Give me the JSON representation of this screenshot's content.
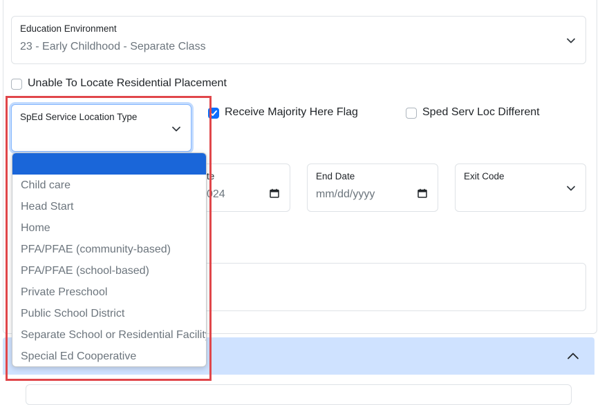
{
  "education_environment": {
    "label": "Education Environment",
    "value": "23 - Early Childhood - Separate Class",
    "icon": "chevron-down-icon"
  },
  "unable_to_locate": {
    "label": "Unable To Locate Residential Placement",
    "checked": false
  },
  "sped_location": {
    "label": "SpEd Service Location Type",
    "value": "",
    "icon": "chevron-down-icon",
    "options": [
      "",
      "Child care",
      "Head Start",
      "Home",
      "PFA/PFAE (community-based)",
      "PFA/PFAE (school-based)",
      "Private Preschool",
      "Public School District",
      "Separate School or Residential Facility",
      "Special Ed Cooperative"
    ],
    "selected_index": 0
  },
  "receive_majority": {
    "label": "Receive Majority Here Flag",
    "checked": true
  },
  "sped_loc_different": {
    "label": "Sped Serv Loc Different",
    "checked": false
  },
  "start_date": {
    "label_partial": "te",
    "value_partial": "024",
    "icon": "calendar-icon"
  },
  "end_date": {
    "label": "End Date",
    "placeholder": "mm/dd/yyyy",
    "icon": "calendar-icon"
  },
  "exit_code": {
    "label": "Exit Code",
    "value": "",
    "icon": "chevron-down-icon"
  },
  "accordion": {
    "icon": "chevron-up-icon"
  },
  "colors": {
    "primary": "#0d6efd",
    "selected_option": "#1a66d9",
    "accordion_bg": "#cfe2ff",
    "highlight": "#e0464a",
    "muted_text": "#6c757d"
  }
}
